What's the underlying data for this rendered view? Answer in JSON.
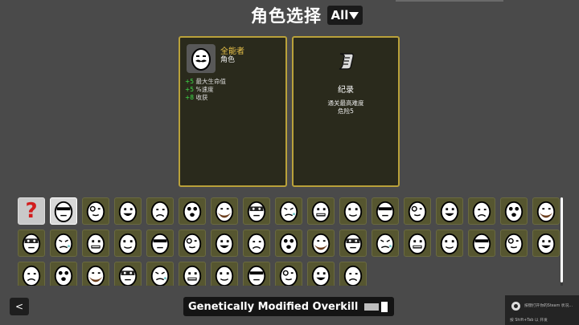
{
  "header": {
    "title": "角色选择",
    "filter_value": "All"
  },
  "selected_character": {
    "name": "全能者",
    "type": "角色",
    "portrait_icon": "potato-mustache-icon",
    "stats": [
      {
        "value": "+5",
        "label": "最大生命值"
      },
      {
        "value": "+5",
        "label": "%速度"
      },
      {
        "value": "+8",
        "label": "收获"
      }
    ]
  },
  "record_panel": {
    "icon": "scroll-icon",
    "title": "纪录",
    "line1": "通关最高难度",
    "line2": "危险5"
  },
  "character_grid": {
    "random_label": "?",
    "items": [
      "random",
      "well-rounded",
      "brawler",
      "crazy",
      "ranger",
      "mage",
      "chunky",
      "old",
      "lucky",
      "mutant",
      "generalist",
      "loud",
      "multitasker",
      "wildling",
      "pacifist",
      "gladiator",
      "saver",
      "sick",
      "farmer",
      "ghost",
      "speedy",
      "entrepreneur",
      "engineer",
      "explorer",
      "doctor",
      "hunter",
      "artificer",
      "arms-dealer",
      "streamer",
      "cyborg",
      "glutton",
      "jack",
      "lich",
      "apprentice",
      "cryptid",
      "fisherman",
      "golem",
      "king",
      "renegade",
      "one-armed",
      "bull",
      "soldier",
      "masochist",
      "knight",
      "demon"
    ]
  },
  "footer": {
    "back_label": "<",
    "weapon_name": "Genetically Modified Overkill"
  },
  "steam_toast": {
    "line1": "按键打开你的Steam 状况...",
    "line2": "按 Shift+Tab 以 开发"
  },
  "colors": {
    "background": "#4a4a4a",
    "panel_border": "#b9a13a",
    "cell_bg": "#565630",
    "stat_positive": "#3ee04a",
    "character_name": "#e9c24a",
    "random_question": "#d21d1d"
  }
}
